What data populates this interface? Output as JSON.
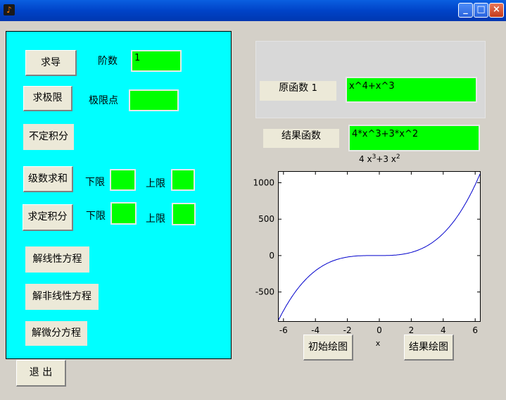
{
  "window": {
    "icon": "matlab-icon",
    "minimize": "_",
    "maximize": "□",
    "close": "×"
  },
  "left_panel": {
    "derivative_button": "求导",
    "order_label": "阶数",
    "order_value": "1",
    "limit_button": "求极限",
    "limit_point_label": "极限点",
    "limit_point_value": "",
    "indefinite_button": "不定积分",
    "series_sum_button": "级数求和",
    "series_lower_label": "下限",
    "series_upper_label": "上限",
    "definite_button": "求定积分",
    "definite_lower_label": "下限",
    "definite_upper_label": "上限",
    "linear_eq_button": "解线性方程",
    "nonlinear_eq_button": "解非线性方程",
    "diff_eq_button": "解微分方程"
  },
  "exit_button": "退 出",
  "right_panel": {
    "original_label": "原函数",
    "original_index": "1",
    "original_value": "x^4+x^3",
    "result_label": "结果函数",
    "result_value": "4*x^3+3*x^2"
  },
  "chart_data": {
    "type": "line",
    "title_base": "4 x",
    "title_exp1": "3",
    "title_mid": "+3 x",
    "title_exp2": "2",
    "xlabel": "x",
    "ylabel": "",
    "xlim": [
      -6.3,
      6.3
    ],
    "ylim": [
      -900,
      1150
    ],
    "xticks": [
      -6,
      -4,
      -2,
      0,
      2,
      4,
      6
    ],
    "yticks": [
      -500,
      0,
      500,
      1000
    ],
    "xtick_labels": [
      "-6",
      "-4",
      "-2",
      "0",
      "2",
      "4",
      "6"
    ],
    "ytick_labels": [
      "-500",
      "0",
      "500",
      "1000"
    ],
    "series": [
      {
        "expression": "4*x^3+3*x^2",
        "color": "#0000cc"
      }
    ]
  },
  "plot_buttons": {
    "initial": "初始绘图",
    "result": "结果绘图"
  }
}
